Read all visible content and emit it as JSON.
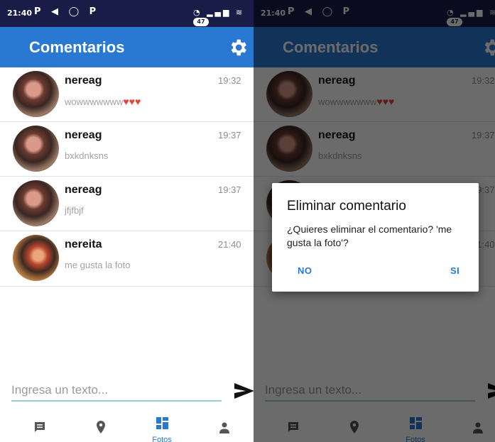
{
  "status": {
    "time": "21:40",
    "battery": "47"
  },
  "app": {
    "title": "Comentarios"
  },
  "comments": [
    {
      "user": "nereag",
      "text": "wowwwwwww",
      "time": "19:32"
    },
    {
      "user": "nereag",
      "text": "bxkdnksns",
      "time": "19:37"
    },
    {
      "user": "nereag",
      "text": "jfjfbjf",
      "time": "19:37"
    },
    {
      "user": "nereita",
      "text": "me gusta la foto",
      "time": "21:40"
    }
  ],
  "input": {
    "placeholder": "Ingresa un texto..."
  },
  "nav": [
    {
      "icon": "comment-icon",
      "label": ""
    },
    {
      "icon": "location-icon",
      "label": ""
    },
    {
      "icon": "grid-icon",
      "label": "Fotos"
    },
    {
      "icon": "person-icon",
      "label": ""
    }
  ],
  "dialog": {
    "title": "Eliminar comentario",
    "message": "¿Quieres eliminar el comentario? 'me gusta la foto'?",
    "no": "NO",
    "yes": "SI"
  },
  "colors": {
    "primary": "#2979d3",
    "status_bar": "#1a1c48",
    "divider": "#e2e2e2"
  }
}
